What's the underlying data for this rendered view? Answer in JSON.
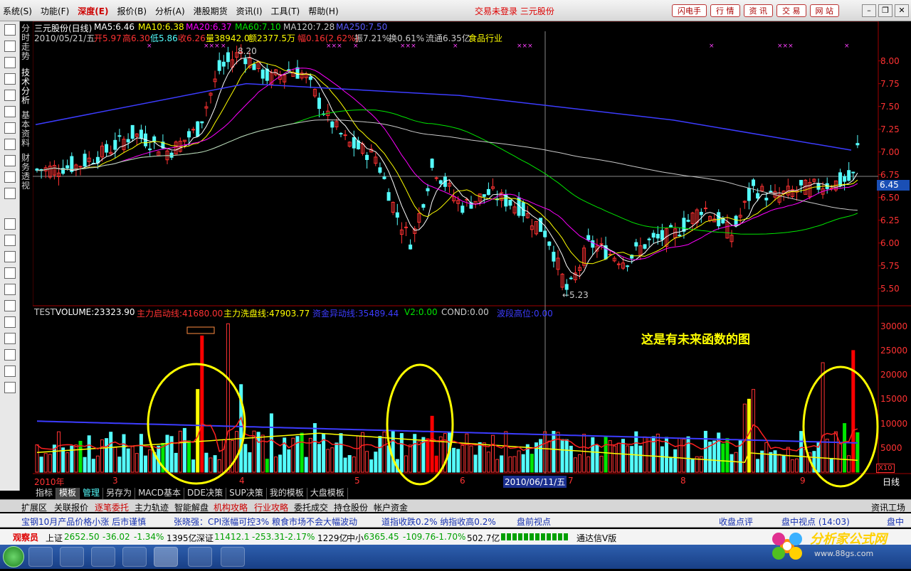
{
  "menubar": {
    "items": [
      "系统(S)",
      "功能(F)",
      "深度(E)",
      "报价(B)",
      "分析(A)",
      "港股期货",
      "资讯(I)",
      "工具(T)",
      "帮助(H)"
    ],
    "center_text": "交易未登录 三元股份",
    "right_buttons": [
      "闪电手",
      "行 情",
      "资 讯",
      "交 易",
      "网 站"
    ]
  },
  "side_tabs": [
    "分时走势",
    "技术分析",
    "基本资料",
    "财务透视"
  ],
  "toolbar_icons": [
    "home-icon",
    "table-icon",
    "line-icon",
    "kline-icon",
    "list-icon",
    "f10-icon",
    "news-icon",
    "f10-icon",
    "f12-icon",
    "f6-icon",
    "search-icon",
    "eft-icon",
    "macd-icon",
    "rsi-icon",
    "calc-icon",
    "dollar-icon",
    "eraser-icon",
    "export-icon",
    "pen-icon",
    "move-icon",
    "up-arrow-icon",
    "down-arrow-icon"
  ],
  "price_header": {
    "stock": "三元股份(日线)",
    "ma5": "MA5:6.46",
    "ma10": "MA10:6.38",
    "ma20": "MA20:6.37",
    "ma60": "MA60:7.10",
    "ma120": "MA120:7.28",
    "ma250": "MA250:7.50",
    "info_date": "2010/05/21/五",
    "open": "开5.97",
    "high": "高6.30",
    "low": "低5.86",
    "close": "收6.26",
    "volume": "量38942.0",
    "amount": "额2377.5万",
    "change": "幅0.16(2.62%)",
    "amplitude": "振7.21%",
    "turnover": "换0.61%",
    "float_cap": "流通6.35亿",
    "industry": "食品行业"
  },
  "annotations": {
    "high": "8.20",
    "low": "←5.23",
    "current_price": "6.45",
    "note": "这是有未来函数的图"
  },
  "price_axis": [
    "8.00",
    "7.75",
    "7.50",
    "7.25",
    "7.00",
    "6.75",
    "6.50",
    "6.25",
    "6.00",
    "5.75",
    "5.50"
  ],
  "volume_axis": [
    "30000",
    "25000",
    "20000",
    "15000",
    "10000",
    "5000"
  ],
  "volume_unit": "X10",
  "indicator_header": {
    "name": "TEST",
    "volume": "VOLUME:23323.90",
    "line1": "主力启动线:41680.00",
    "line2": "主力洗盘线:47903.77",
    "line3": "资金异动线:35489.44",
    "v2": "V2:0.00",
    "cond": "COND:0.00",
    "line4": "波段高位:0.00"
  },
  "date_axis": {
    "labels": [
      "2010年",
      "3",
      "4",
      "5",
      "6",
      "7",
      "8",
      "9"
    ],
    "cursor": "2010/06/11/五",
    "period": "日线"
  },
  "bottom_tabs": [
    "指标",
    "模板",
    "管理",
    "另存为",
    "MACD基本",
    "DDE决策",
    "SUP决策",
    "我的模板",
    "大盘模板"
  ],
  "row_tabs": [
    "扩展区",
    "关联报价",
    "逐笔委托",
    "主力轨迹",
    "智能解盘",
    "机构攻略",
    "行业攻略",
    "委托成交",
    "持仓股份",
    "帐户资金"
  ],
  "row_right": "资讯工场",
  "ticker": [
    "宝钢10月产品价格小涨 后市谨慎",
    "张晓强：CPI涨幅可控3% 粮食市场不会大幅波动",
    "道指收跌0.2% 纳指收高0.2%",
    "盘前视点",
    "收盘点评",
    "盘中视点 (14:03)",
    "盘中"
  ],
  "index_bar": {
    "badge": "观察员",
    "sh": {
      "name": "上证",
      "value": "2652.50",
      "chg": "-36.02",
      "pct": "-1.34%",
      "amt": "1395亿"
    },
    "sz": {
      "name": "深证",
      "value": "11412.1",
      "chg": "-253.31",
      "pct": "-2.17%",
      "amt": "1229亿"
    },
    "zx": {
      "name": "中小",
      "value": "6365.45",
      "chg": "-109.76",
      "pct": "-1.70%",
      "amt": "502.7亿"
    },
    "version": "通达信V版"
  },
  "logo": {
    "title": "分析家公式网",
    "url": "www.88gs.com"
  },
  "colors": {
    "up": "#ff3232",
    "down": "#54fcfc",
    "ma5": "#ffffff",
    "ma10": "#ffff00",
    "ma20": "#ff00ff",
    "ma60": "#00e600",
    "ma120": "#c8c8c8",
    "ma250": "#3c3cff"
  }
}
